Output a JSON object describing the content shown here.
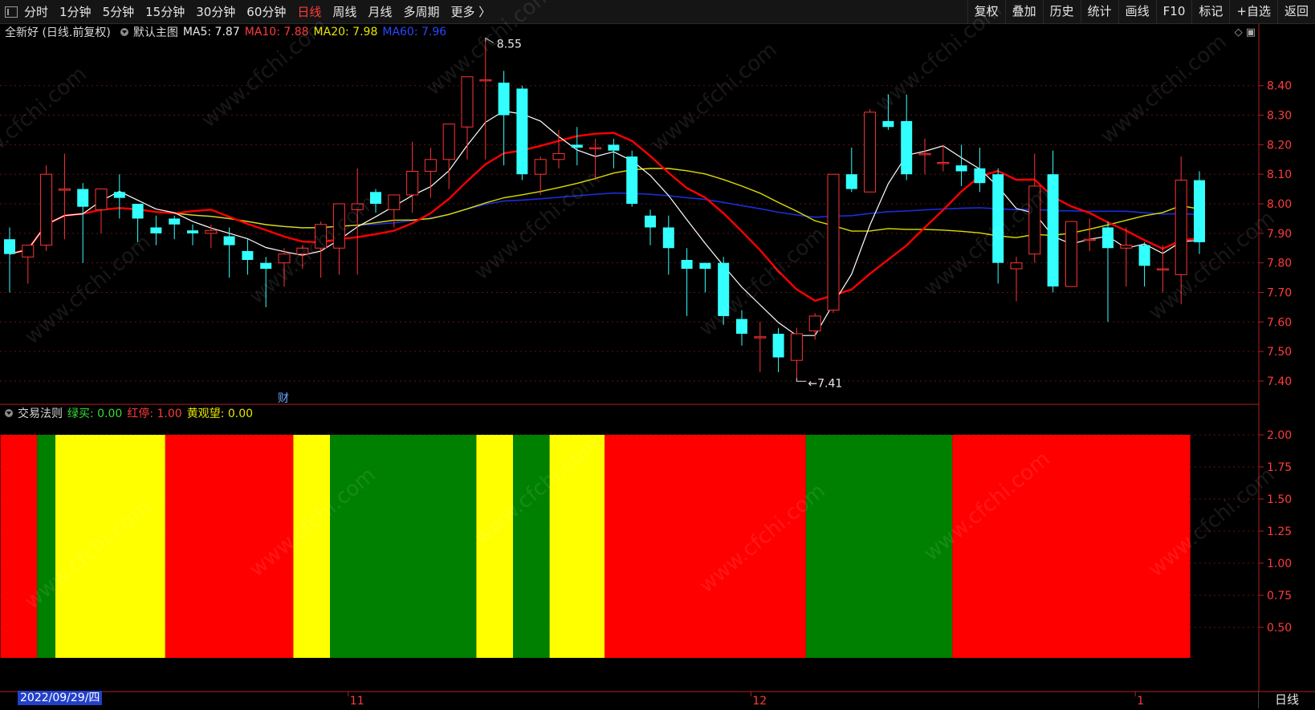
{
  "toolbar": {
    "periods": [
      "分时",
      "1分钟",
      "5分钟",
      "15分钟",
      "30分钟",
      "60分钟",
      "日线",
      "周线",
      "月线",
      "多周期",
      "更多 〉"
    ],
    "active_period": "日线",
    "right_buttons": [
      "复权",
      "叠加",
      "历史",
      "统计",
      "画线",
      "F10",
      "标记",
      "+自选",
      "返回"
    ]
  },
  "main_info": {
    "title": "全新好 (日线.前复权)",
    "template": "默认主图",
    "ma5": "MA5: 7.87",
    "ma10": "MA10: 7.88",
    "ma20": "MA20: 7.98",
    "ma60": "MA60: 7.96"
  },
  "sub_info": {
    "title": "交易法则",
    "green": "绿买: 0.00",
    "red": "红停: 1.00",
    "yellow": "黄观望: 0.00"
  },
  "annotations": {
    "high": "8.55",
    "low": "7.41",
    "finance_marker": "财"
  },
  "price_axis": [
    "8.40",
    "8.30",
    "8.20",
    "8.10",
    "8.00",
    "7.90",
    "7.80",
    "7.70",
    "7.60",
    "7.50",
    "7.40"
  ],
  "indicator_axis": [
    "2.00",
    "1.75",
    "1.50",
    "1.25",
    "1.00",
    "0.75",
    "0.50"
  ],
  "date_axis": {
    "selected": "2022/09/29/四",
    "months": [
      "11",
      "12",
      "1"
    ]
  },
  "bottom_tab": "日线",
  "watermark": "www.cfchi.com",
  "colors": {
    "up": "#ff3333",
    "down": "#33ffff",
    "ma5": "#ffffff",
    "ma10": "#ff0000",
    "ma20": "#dddd00",
    "ma60": "#1a2ed8",
    "band_red": "#ff0000",
    "band_green": "#008000",
    "band_yellow": "#ffff00"
  },
  "chart_data": [
    {
      "type": "candlestick",
      "series_ohlc": [
        [
          7.88,
          7.92,
          7.7,
          7.83
        ],
        [
          7.82,
          7.86,
          7.73,
          7.86
        ],
        [
          7.86,
          8.13,
          7.84,
          8.1
        ],
        [
          8.05,
          8.17,
          7.88,
          8.05
        ],
        [
          8.05,
          8.07,
          7.8,
          7.99
        ],
        [
          7.98,
          8.05,
          7.9,
          8.05
        ],
        [
          8.04,
          8.1,
          7.95,
          8.02
        ],
        [
          8.0,
          8.0,
          7.87,
          7.95
        ],
        [
          7.92,
          7.96,
          7.86,
          7.9
        ],
        [
          7.95,
          7.96,
          7.88,
          7.93
        ],
        [
          7.91,
          7.93,
          7.86,
          7.9
        ],
        [
          7.9,
          7.93,
          7.85,
          7.91
        ],
        [
          7.89,
          7.92,
          7.75,
          7.86
        ],
        [
          7.84,
          7.88,
          7.76,
          7.81
        ],
        [
          7.8,
          7.82,
          7.65,
          7.78
        ],
        [
          7.8,
          7.85,
          7.72,
          7.83
        ],
        [
          7.83,
          7.86,
          7.78,
          7.85
        ],
        [
          7.85,
          7.94,
          7.75,
          7.93
        ],
        [
          7.85,
          8.0,
          7.76,
          8.0
        ],
        [
          7.98,
          8.12,
          7.76,
          8.0
        ],
        [
          8.04,
          8.05,
          7.97,
          8.0
        ],
        [
          7.98,
          8.0,
          7.92,
          8.03
        ],
        [
          8.03,
          8.21,
          7.97,
          8.11
        ],
        [
          8.11,
          8.19,
          8.02,
          8.15
        ],
        [
          8.15,
          8.24,
          8.05,
          8.27
        ],
        [
          8.26,
          8.28,
          8.15,
          8.43
        ],
        [
          8.42,
          8.55,
          8.15,
          8.42
        ],
        [
          8.41,
          8.45,
          8.13,
          8.3
        ],
        [
          8.39,
          8.4,
          8.08,
          8.1
        ],
        [
          8.1,
          8.16,
          8.03,
          8.15
        ],
        [
          8.15,
          8.25,
          8.12,
          8.17
        ],
        [
          8.2,
          8.26,
          8.13,
          8.19
        ],
        [
          8.19,
          8.22,
          8.08,
          8.19
        ],
        [
          8.2,
          8.22,
          8.12,
          8.18
        ],
        [
          8.16,
          8.18,
          7.99,
          8.0
        ],
        [
          7.96,
          7.98,
          7.86,
          7.92
        ],
        [
          7.92,
          7.96,
          7.76,
          7.85
        ],
        [
          7.81,
          7.85,
          7.62,
          7.78
        ],
        [
          7.8,
          7.8,
          7.7,
          7.78
        ],
        [
          7.8,
          7.82,
          7.59,
          7.62
        ],
        [
          7.61,
          7.64,
          7.52,
          7.56
        ],
        [
          7.55,
          7.6,
          7.43,
          7.55
        ],
        [
          7.56,
          7.58,
          7.43,
          7.48
        ],
        [
          7.47,
          7.58,
          7.41,
          7.56
        ],
        [
          7.57,
          7.63,
          7.54,
          7.62
        ],
        [
          7.64,
          8.1,
          7.63,
          8.1
        ],
        [
          8.1,
          8.19,
          8.04,
          8.05
        ],
        [
          8.04,
          8.32,
          8.04,
          8.31
        ],
        [
          8.28,
          8.37,
          8.25,
          8.26
        ],
        [
          8.28,
          8.37,
          8.08,
          8.1
        ],
        [
          8.17,
          8.22,
          8.1,
          8.17
        ],
        [
          8.14,
          8.2,
          8.11,
          8.14
        ],
        [
          8.13,
          8.2,
          8.06,
          8.11
        ],
        [
          8.12,
          8.19,
          8.04,
          8.07
        ],
        [
          8.1,
          8.12,
          7.73,
          7.8
        ],
        [
          7.78,
          7.82,
          7.67,
          7.8
        ],
        [
          7.83,
          8.17,
          7.8,
          8.06
        ],
        [
          8.1,
          8.18,
          7.7,
          7.72
        ],
        [
          7.72,
          7.94,
          7.72,
          7.94
        ],
        [
          7.88,
          7.95,
          7.84,
          7.88
        ],
        [
          7.92,
          7.94,
          7.6,
          7.85
        ],
        [
          7.85,
          7.92,
          7.72,
          7.86
        ],
        [
          7.86,
          7.87,
          7.72,
          7.79
        ],
        [
          7.78,
          7.86,
          7.7,
          7.78
        ],
        [
          7.76,
          8.16,
          7.66,
          8.08
        ],
        [
          8.08,
          8.11,
          7.83,
          7.87
        ]
      ]
    },
    {
      "type": "bar",
      "categories": [
        "band1",
        "band2",
        "band3",
        "band4",
        "band5",
        "band6",
        "band7",
        "band8",
        "band9",
        "band10",
        "band11",
        "band12",
        "band13"
      ],
      "series": [
        {
          "values": [
            2,
            2,
            2,
            2,
            2,
            2,
            2,
            2,
            2,
            2,
            2,
            2,
            2
          ]
        }
      ],
      "band_colors": [
        "red",
        "green",
        "yellow",
        "red",
        "yellow",
        "green",
        "yellow",
        "green",
        "yellow",
        "red",
        "green",
        "red"
      ],
      "band_ranges": [
        [
          0,
          2
        ],
        [
          2,
          3
        ],
        [
          3,
          9
        ],
        [
          9,
          16
        ],
        [
          16,
          18
        ],
        [
          18,
          26
        ],
        [
          26,
          28
        ],
        [
          28,
          30
        ],
        [
          30,
          33
        ],
        [
          33,
          44
        ],
        [
          44,
          52
        ],
        [
          52,
          65
        ]
      ],
      "ylim": [
        0,
        2.2
      ]
    }
  ]
}
